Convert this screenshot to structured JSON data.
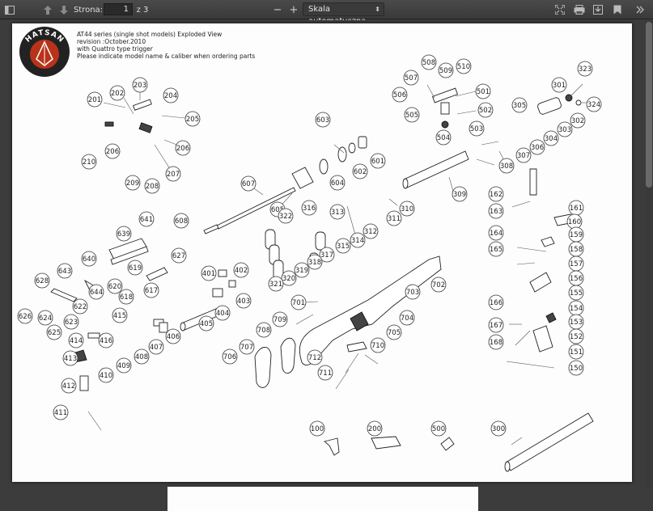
{
  "toolbar": {
    "page_label": "Strona:",
    "page_current": "1",
    "page_total": "z 3",
    "zoom_minus": "−",
    "zoom_plus": "+",
    "zoom_value": "Skala automatyczna"
  },
  "document": {
    "header_lines": [
      "AT44 series (single shot models) Exploded View",
      "revision :October.2010",
      "with Quattro type trigger",
      "Please indicate model name & caliber when ordering parts"
    ],
    "logo_text": "HATSAN"
  },
  "callouts": [
    {
      "label": "201"
    },
    {
      "label": "202"
    },
    {
      "label": "203"
    },
    {
      "label": "204"
    },
    {
      "label": "205"
    },
    {
      "label": "206"
    },
    {
      "label": "206"
    },
    {
      "label": "207"
    },
    {
      "label": "208"
    },
    {
      "label": "209"
    },
    {
      "label": "210"
    },
    {
      "label": "507"
    },
    {
      "label": "508"
    },
    {
      "label": "509"
    },
    {
      "label": "510"
    },
    {
      "label": "506"
    },
    {
      "label": "505"
    },
    {
      "label": "504"
    },
    {
      "label": "503"
    },
    {
      "label": "502"
    },
    {
      "label": "501"
    },
    {
      "label": "323"
    },
    {
      "label": "301"
    },
    {
      "label": "324"
    },
    {
      "label": "305"
    },
    {
      "label": "302"
    },
    {
      "label": "303"
    },
    {
      "label": "304"
    },
    {
      "label": "306"
    },
    {
      "label": "307"
    },
    {
      "label": "308"
    },
    {
      "label": "603"
    },
    {
      "label": "602"
    },
    {
      "label": "601"
    },
    {
      "label": "604"
    },
    {
      "label": "605"
    },
    {
      "label": "607"
    },
    {
      "label": "608"
    },
    {
      "label": "309"
    },
    {
      "label": "313"
    },
    {
      "label": "310"
    },
    {
      "label": "311"
    },
    {
      "label": "312"
    },
    {
      "label": "314"
    },
    {
      "label": "315"
    },
    {
      "label": "316"
    },
    {
      "label": "317"
    },
    {
      "label": "318"
    },
    {
      "label": "319"
    },
    {
      "label": "320"
    },
    {
      "label": "321"
    },
    {
      "label": "322"
    },
    {
      "label": "641"
    },
    {
      "label": "639"
    },
    {
      "label": "640"
    },
    {
      "label": "627"
    },
    {
      "label": "619"
    },
    {
      "label": "620"
    },
    {
      "label": "618"
    },
    {
      "label": "617"
    },
    {
      "label": "643"
    },
    {
      "label": "644"
    },
    {
      "label": "628"
    },
    {
      "label": "622"
    },
    {
      "label": "626"
    },
    {
      "label": "624"
    },
    {
      "label": "623"
    },
    {
      "label": "625"
    },
    {
      "label": "401"
    },
    {
      "label": "402"
    },
    {
      "label": "403"
    },
    {
      "label": "404"
    },
    {
      "label": "405"
    },
    {
      "label": "415"
    },
    {
      "label": "414"
    },
    {
      "label": "416"
    },
    {
      "label": "413"
    },
    {
      "label": "410"
    },
    {
      "label": "409"
    },
    {
      "label": "408"
    },
    {
      "label": "407"
    },
    {
      "label": "406"
    },
    {
      "label": "412"
    },
    {
      "label": "411"
    },
    {
      "label": "702"
    },
    {
      "label": "703"
    },
    {
      "label": "701"
    },
    {
      "label": "704"
    },
    {
      "label": "705"
    },
    {
      "label": "709"
    },
    {
      "label": "708"
    },
    {
      "label": "707"
    },
    {
      "label": "706"
    },
    {
      "label": "712"
    },
    {
      "label": "710"
    },
    {
      "label": "711"
    },
    {
      "label": "162"
    },
    {
      "label": "161"
    },
    {
      "label": "163"
    },
    {
      "label": "160"
    },
    {
      "label": "164"
    },
    {
      "label": "159"
    },
    {
      "label": "165"
    },
    {
      "label": "158"
    },
    {
      "label": "157"
    },
    {
      "label": "156"
    },
    {
      "label": "155"
    },
    {
      "label": "166"
    },
    {
      "label": "154"
    },
    {
      "label": "153"
    },
    {
      "label": "167"
    },
    {
      "label": "152"
    },
    {
      "label": "168"
    },
    {
      "label": "151"
    },
    {
      "label": "150"
    },
    {
      "label": "100"
    },
    {
      "label": "200"
    },
    {
      "label": "500"
    },
    {
      "label": "300"
    }
  ]
}
